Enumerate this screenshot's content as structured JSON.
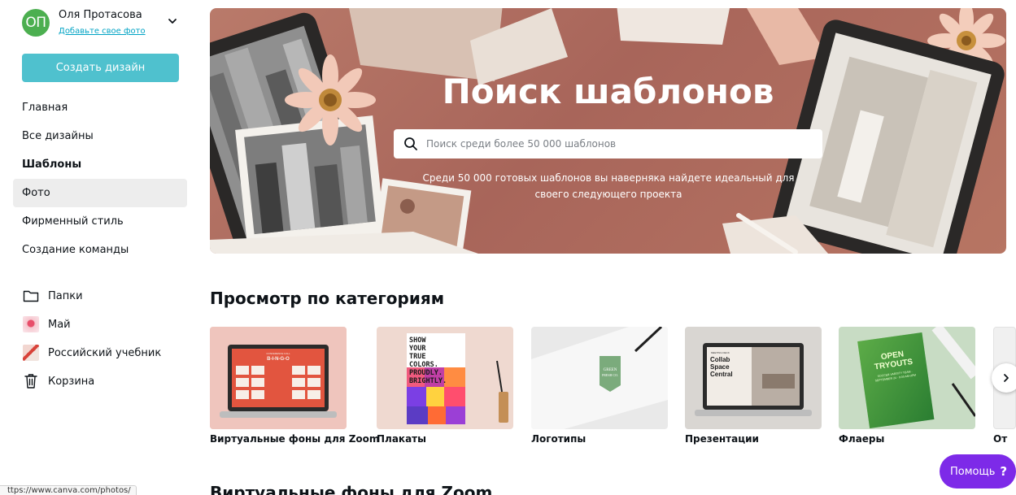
{
  "user": {
    "initials": "ОП",
    "name": "Оля Протасова",
    "add_photo_link": "Добавьте свое фото"
  },
  "sidebar": {
    "create_button": "Создать дизайн",
    "nav": [
      {
        "label": "Главная"
      },
      {
        "label": "Все дизайны"
      },
      {
        "label": "Шаблоны"
      },
      {
        "label": "Фото"
      },
      {
        "label": "Фирменный стиль"
      },
      {
        "label": "Создание команды"
      }
    ],
    "folders": [
      {
        "label": "Папки",
        "icon": "folder-icon"
      },
      {
        "label": "Май",
        "icon": "thumbnail-icon"
      },
      {
        "label": "Российский учебник",
        "icon": "thumbnail-icon"
      },
      {
        "label": "Корзина",
        "icon": "trash-icon"
      }
    ]
  },
  "hero": {
    "title": "Поиск шаблонов",
    "search_placeholder": "Поиск среди более 50 000 шаблонов",
    "subtitle": "Среди 50 000 готовых шаблонов вы наверняка найдете идеальный для своего следующего проекта"
  },
  "categories": {
    "title": "Просмотр по категориям",
    "items": [
      {
        "label": "Виртуальные фоны для Zoom"
      },
      {
        "label": "Плакаты"
      },
      {
        "label": "Логотипы"
      },
      {
        "label": "Презентации"
      },
      {
        "label": "Флаеры"
      },
      {
        "label": "От"
      }
    ]
  },
  "thumbnails": {
    "bingo_small": "CONFERENCE CALL",
    "bingo": "B-I-N-G-O",
    "poster": "SHOW YOUR TRUE COLORS. PROUDLY. BRIGHTLY.",
    "logo_line1": "GREEN",
    "logo_line2": "FRESH CO.",
    "presentation_small": "MEETING DECK",
    "presentation": "Collab Space Central",
    "flyer_title1": "OPEN",
    "flyer_title2": "TRYOUTS",
    "flyer_sub": "SOCCER VARSITY TEAM · SEPTEMBER 24 · 9:00 AM-3PM"
  },
  "help_button": {
    "label": "Помощь",
    "icon": "?"
  },
  "next_section_title": "Виртуальные фоны для Zoom",
  "status_url": "ttps://www.canva.com/photos/",
  "colors": {
    "accent": "#4fc1ce",
    "help": "#7d2ae8",
    "avatar": "#4caf50",
    "hero": "#b07065"
  }
}
